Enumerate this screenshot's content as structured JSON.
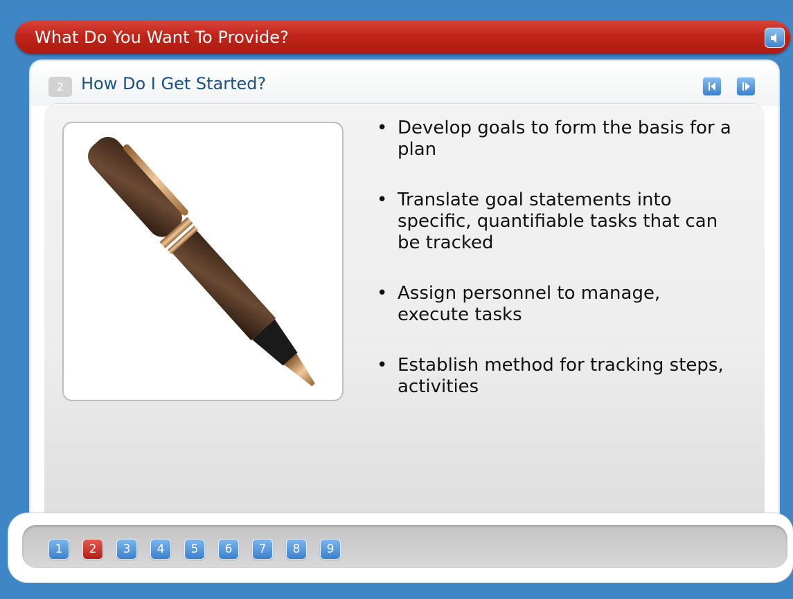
{
  "header": {
    "title": "What Do You Want To Provide?",
    "audio_icon": "speaker-icon"
  },
  "slide": {
    "number": "2",
    "title": "How Do I Get Started?",
    "prev_icon": "previous-icon",
    "next_icon": "next-icon",
    "image": "fountain-pen",
    "bullets": [
      "Develop goals to form the basis for a plan",
      "Translate goal statements into specific, quantifiable tasks that can be tracked",
      "Assign personnel to manage, execute tasks",
      "Establish method for tracking steps, activities"
    ]
  },
  "pagination": {
    "pages": [
      "1",
      "2",
      "3",
      "4",
      "5",
      "6",
      "7",
      "8",
      "9"
    ],
    "current": "2"
  },
  "colors": {
    "background": "#3f86c6",
    "title_bar": "#c02418",
    "button_blue": "#3a7fcf",
    "active_page": "#b51d14",
    "slide_title": "#1a4f86"
  }
}
